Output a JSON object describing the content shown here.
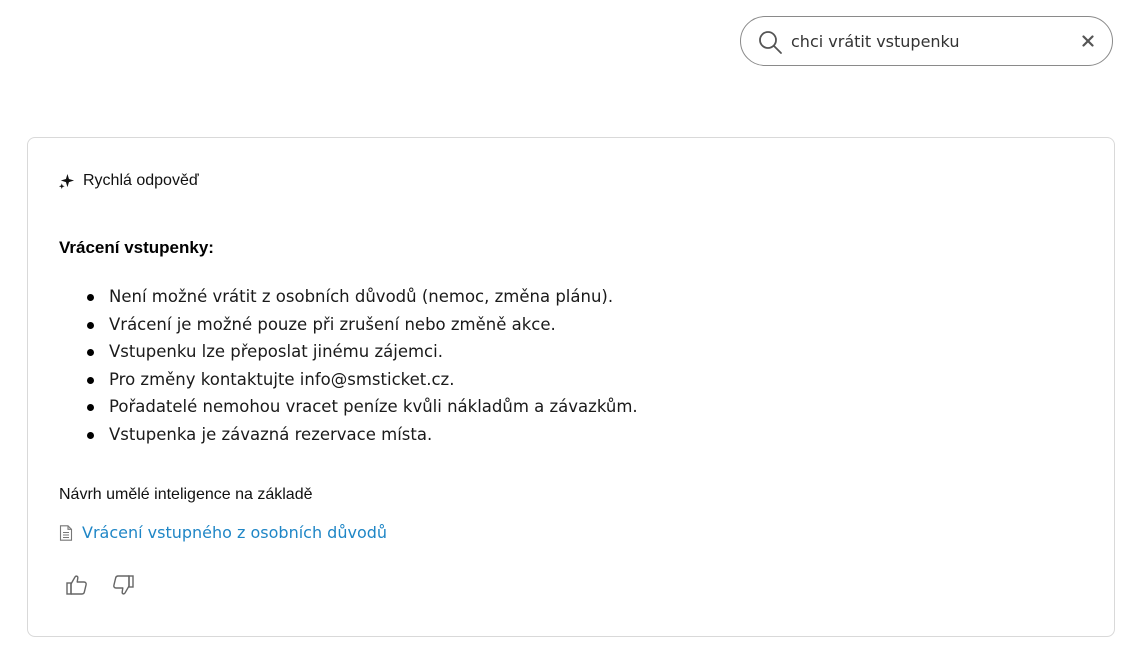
{
  "search": {
    "value": "chci vrátit vstupenku",
    "search_icon": "search-icon",
    "clear_icon": "close-icon"
  },
  "answer_card": {
    "header_icon": "sparkle-icon",
    "header_label": "Rychlá odpověď",
    "title": "Vrácení vstupenky:",
    "items": [
      "Není možné vrátit z osobních důvodů (nemoc, změna plánu).",
      "Vrácení je možné pouze při zrušení nebo změně akce.",
      "Vstupenku lze přeposlat jinému zájemci.",
      "Pro změny kontaktujte info@smsticket.cz.",
      "Pořadatelé nemohou vracet peníze kvůli nákladům a závazkům.",
      "Vstupenka je závazná rezervace místa."
    ],
    "source_label": "Návrh umělé inteligence na základě",
    "source_icon": "document-icon",
    "source_link": "Vrácení vstupného z osobních důvodů",
    "feedback": {
      "like_icon": "thumbs-up-icon",
      "dislike_icon": "thumbs-down-icon"
    }
  },
  "colors": {
    "link": "#1f86c6",
    "border": "#d9d9d9",
    "search_border": "#8a8a8a"
  }
}
